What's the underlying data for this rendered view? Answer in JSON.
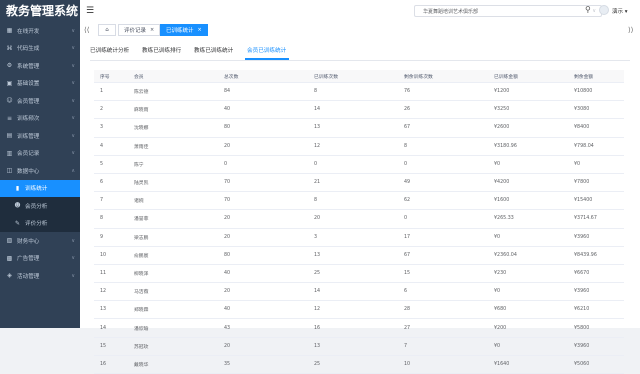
{
  "app": {
    "title": "教务管理系统"
  },
  "sidebar": {
    "items": [
      {
        "label": "在线开发",
        "icon": "grid-icon"
      },
      {
        "label": "代码生成",
        "icon": "code-icon"
      },
      {
        "label": "系统管理",
        "icon": "settings-icon"
      },
      {
        "label": "基础设置",
        "icon": "config-icon"
      },
      {
        "label": "会员管理",
        "icon": "user-icon"
      },
      {
        "label": "训练频次",
        "icon": "list-icon"
      },
      {
        "label": "训练管理",
        "icon": "book-icon"
      },
      {
        "label": "会员记录",
        "icon": "record-icon"
      },
      {
        "label": "数据中心",
        "icon": "data-icon"
      }
    ],
    "sub_items": [
      {
        "label": "训练统计",
        "icon": "chart-icon"
      },
      {
        "label": "会员分析",
        "icon": "user-analysis-icon"
      },
      {
        "label": "评价分析",
        "icon": "review-icon"
      }
    ],
    "bottom_items": [
      {
        "label": "财务中心",
        "icon": "finance-icon"
      },
      {
        "label": "广告管理",
        "icon": "ad-icon"
      },
      {
        "label": "活动管理",
        "icon": "activity-icon"
      }
    ]
  },
  "topbar": {
    "org_select": "华夏舞蹈培训艺术俱乐部",
    "user_name": "演示"
  },
  "tags": {
    "items": [
      {
        "label": "评价记录"
      },
      {
        "label": "已训练统计"
      }
    ]
  },
  "tabs": {
    "items": [
      {
        "label": "已训练统计分析"
      },
      {
        "label": "教练已训练排行"
      },
      {
        "label": "教练已训练统计"
      },
      {
        "label": "会员已训练统计"
      }
    ],
    "active_index": 3
  },
  "table": {
    "headers": [
      "序号",
      "会员",
      "总次数",
      "已训练次数",
      "剩余训练次数",
      "已训练金额",
      "剩余金额"
    ],
    "rows": [
      [
        "1",
        "陈云德",
        "84",
        "8",
        "76",
        "¥1200",
        "¥10800"
      ],
      [
        "2",
        "麻晓雨",
        "40",
        "14",
        "26",
        "¥3250",
        "¥3080"
      ],
      [
        "3",
        "沈晓娜",
        "80",
        "13",
        "67",
        "¥2600",
        "¥8400"
      ],
      [
        "4",
        "萧雨佳",
        "20",
        "12",
        "8",
        "¥3180.96",
        "¥798.04"
      ],
      [
        "5",
        "陈宁",
        "0",
        "0",
        "0",
        "¥0",
        "¥0"
      ],
      [
        "6",
        "陆灵凯",
        "70",
        "21",
        "49",
        "¥4200",
        "¥7800"
      ],
      [
        "7",
        "诸婉",
        "70",
        "8",
        "62",
        "¥1600",
        "¥15400"
      ],
      [
        "8",
        "潘誉菲",
        "20",
        "20",
        "0",
        "¥265.33",
        "¥3714.67"
      ],
      [
        "9",
        "梁志鹏",
        "20",
        "3",
        "17",
        "¥0",
        "¥3960"
      ],
      [
        "10",
        "俞鹏宸",
        "80",
        "13",
        "67",
        "¥2360.04",
        "¥8439.96"
      ],
      [
        "11",
        "柳晓泽",
        "40",
        "25",
        "15",
        "¥230",
        "¥6670"
      ],
      [
        "12",
        "马洁薇",
        "20",
        "14",
        "6",
        "¥0",
        "¥3960"
      ],
      [
        "13",
        "郑晓霖",
        "40",
        "12",
        "28",
        "¥680",
        "¥6210"
      ],
      [
        "14",
        "潘欣瑜",
        "43",
        "16",
        "27",
        "¥200",
        "¥5800"
      ],
      [
        "15",
        "苏冠玫",
        "20",
        "13",
        "7",
        "¥0",
        "¥3960"
      ],
      [
        "16",
        "戴晓华",
        "35",
        "25",
        "10",
        "¥1640",
        "¥5060"
      ]
    ]
  },
  "colors": {
    "sidebar_bg": "#304156",
    "sidebar_sub_bg": "#1f2d3d",
    "accent": "#1890ff"
  }
}
